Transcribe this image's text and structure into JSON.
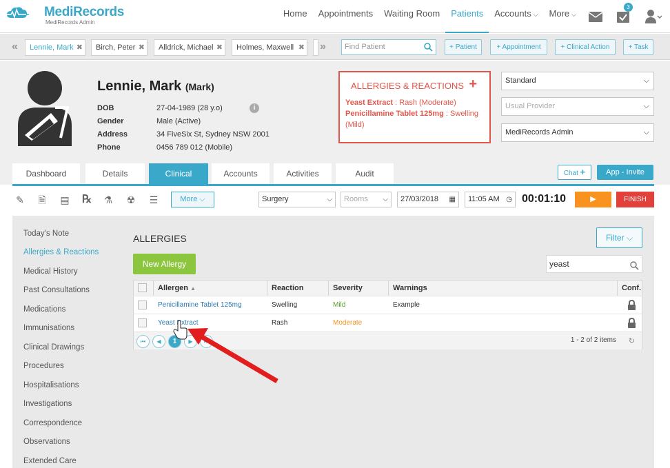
{
  "brand": {
    "name_part1": "Medi",
    "name_part2": "Records",
    "subtitle": "MediRecords Admin"
  },
  "nav": {
    "items": [
      {
        "label": "Home"
      },
      {
        "label": "Appointments"
      },
      {
        "label": "Waiting Room"
      },
      {
        "label": "Patients"
      },
      {
        "label": "Accounts"
      },
      {
        "label": "More"
      }
    ],
    "active": "Patients",
    "tasks_badge": "3",
    "accent_color": "#3aa8c9"
  },
  "patient_tabs": [
    {
      "label": "Lennie, Mark"
    },
    {
      "label": "Birch, Peter"
    },
    {
      "label": "Alldrick, Michael"
    },
    {
      "label": "Holmes, Maxwell"
    }
  ],
  "find_patient_placeholder": "Find Patient",
  "quick_actions": [
    "+ Patient",
    "+ Appointment",
    "+ Clinical Action",
    "+ Task"
  ],
  "patient": {
    "name": "Lennie, Mark",
    "nickname": "(Mark)",
    "fields": [
      {
        "label": "DOB",
        "value": "27-04-1989 (28 y.o)"
      },
      {
        "label": "Gender",
        "value": "Male (Active)"
      },
      {
        "label": "Address",
        "value": "34 FiveSix St, Sydney NSW 2001"
      },
      {
        "label": "Phone",
        "value": "0456 789 012 (Mobile)"
      }
    ]
  },
  "allergy_panel": {
    "title": "ALLERGIES & REACTIONS",
    "items": [
      {
        "name": "Yeast Extract",
        "detail": ": Rash (Moderate)"
      },
      {
        "name": "Penicillamine Tablet 125mg",
        "detail": ": Swelling (Mild)"
      }
    ],
    "color": "#e2554a"
  },
  "right_selects": {
    "standard": "Standard",
    "provider_placeholder": "Usual Provider",
    "admin": "MediRecords Admin"
  },
  "section_tabs": [
    "Dashboard",
    "Details",
    "Clinical",
    "Accounts",
    "Activities",
    "Audit"
  ],
  "active_section_tab": "Clinical",
  "chat_label": "Chat",
  "invite_label": "App - Invite",
  "toolbar": {
    "more_label": "More",
    "surgery": "Surgery",
    "rooms_placeholder": "Rooms",
    "date": "27/03/2018",
    "time": "11:05 AM",
    "timer": "00:01:10",
    "finish_label": "FINISH",
    "play_color": "#f7931e",
    "finish_color": "#e2403a"
  },
  "sidenav": [
    "Today's Note",
    "Allergies & Reactions",
    "Medical History",
    "Past Consultations",
    "Medications",
    "Immunisations",
    "Clinical Drawings",
    "Procedures",
    "Hospitalisations",
    "Investigations",
    "Correspondence",
    "Observations",
    "Extended Care"
  ],
  "sidenav_active": "Allergies & Reactions",
  "allergies": {
    "title": "ALLERGIES",
    "filter_label": "Filter",
    "new_label": "New Allergy",
    "search_value": "yeast",
    "columns": [
      "Allergen",
      "Reaction",
      "Severity",
      "Warnings",
      "Conf."
    ],
    "rows": [
      {
        "allergen": "Penicillamine Tablet 125mg",
        "reaction": "Swelling",
        "severity": "Mild",
        "warnings": "Example"
      },
      {
        "allergen": "Yeast Extract",
        "reaction": "Rash",
        "severity": "Moderate",
        "warnings": ""
      }
    ],
    "current_page": "1",
    "pager_info": "1 - 2 of 2 items"
  }
}
